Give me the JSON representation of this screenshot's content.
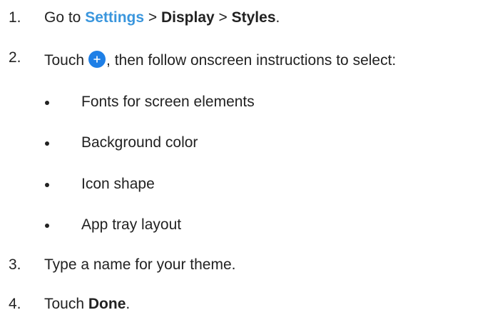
{
  "steps": [
    {
      "number": "1.",
      "prefix": "Go to ",
      "link": "Settings",
      "sep1": " > ",
      "bold1": "Display",
      "sep2": " > ",
      "bold2": "Styles",
      "suffix": "."
    },
    {
      "number": "2.",
      "prefix": "Touch",
      "icon": "add-icon",
      "suffix": ", then follow onscreen instructions to select:",
      "bullets": [
        "Fonts for screen elements",
        "Background color",
        "Icon shape",
        "App tray layout"
      ]
    },
    {
      "number": "3.",
      "text": "Type a name for your theme."
    },
    {
      "number": "4.",
      "prefix": "Touch ",
      "bold": "Done",
      "suffix": "."
    }
  ],
  "colors": {
    "link": "#3a96dd",
    "icon_background": "#1e7fe6",
    "text": "#222222"
  }
}
